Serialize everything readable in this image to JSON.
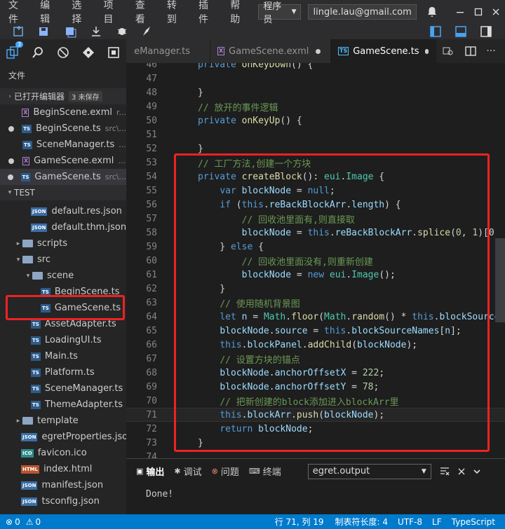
{
  "menu": [
    "文件",
    "编辑",
    "选择",
    "项目",
    "查看",
    "转到",
    "插件",
    "帮助"
  ],
  "account": {
    "role": "程序员",
    "email": "lingle.lau@gmail.com"
  },
  "activity": {
    "badge": "3"
  },
  "tabs": [
    {
      "label": "SceneManager.ts",
      "icon": "TS"
    },
    {
      "label": "GameScene.exml",
      "icon": "X"
    },
    {
      "label": "GameScene.ts",
      "icon": "TS"
    }
  ],
  "sidebar": {
    "title": "文件",
    "open_editors": {
      "label": "已打开编辑器",
      "badge": "3 未保存"
    },
    "open_files": [
      {
        "name": "BeginScene.exml",
        "path": "r...",
        "icon": "X",
        "dirty": false
      },
      {
        "name": "BeginScene.ts",
        "path": "src\\...",
        "icon": "TS",
        "dirty": true
      },
      {
        "name": "SceneManager.ts",
        "path": "...",
        "icon": "TS",
        "dirty": false
      },
      {
        "name": "GameScene.exml",
        "path": "...",
        "icon": "X",
        "dirty": true
      },
      {
        "name": "GameScene.ts",
        "path": "src\\...",
        "icon": "TS",
        "dirty": true
      }
    ],
    "project": "TEST",
    "tree": [
      {
        "name": "default.res.json",
        "icon": "JSON",
        "indent": 44
      },
      {
        "name": "default.thm.json",
        "icon": "JSON",
        "indent": 44
      },
      {
        "name": "scripts",
        "icon": "folder",
        "indent": 20,
        "arrow": "▸"
      },
      {
        "name": "src",
        "icon": "folder",
        "indent": 20,
        "arrow": "▾"
      },
      {
        "name": "scene",
        "icon": "folder",
        "indent": 34,
        "arrow": "▾"
      },
      {
        "name": "BeginScene.ts",
        "icon": "TS",
        "indent": 58
      },
      {
        "name": "GameScene.ts",
        "icon": "TS",
        "indent": 58
      },
      {
        "name": "AssetAdapter.ts",
        "icon": "TS",
        "indent": 44
      },
      {
        "name": "LoadingUI.ts",
        "icon": "TS",
        "indent": 44
      },
      {
        "name": "Main.ts",
        "icon": "TS",
        "indent": 44
      },
      {
        "name": "Platform.ts",
        "icon": "TS",
        "indent": 44
      },
      {
        "name": "SceneManager.ts",
        "icon": "TS",
        "indent": 44
      },
      {
        "name": "ThemeAdapter.ts",
        "icon": "TS",
        "indent": 44
      },
      {
        "name": "template",
        "icon": "folder",
        "indent": 20,
        "arrow": "▸"
      },
      {
        "name": "egretProperties.json",
        "icon": "JSON",
        "indent": 30
      },
      {
        "name": "favicon.ico",
        "icon": "ICO",
        "indent": 30
      },
      {
        "name": "index.html",
        "icon": "HTML",
        "indent": 30
      },
      {
        "name": "manifest.json",
        "icon": "JSON",
        "indent": 30
      },
      {
        "name": "tsconfig.json",
        "icon": "JSON",
        "indent": 30
      }
    ]
  },
  "code": [
    {
      "n": "46",
      "t": [
        [
          "kw",
          "private "
        ],
        [
          "fn",
          "onKeyDown"
        ],
        [
          "",
          "() {"
        ]
      ]
    },
    {
      "n": "47",
      "t": []
    },
    {
      "n": "48",
      "t": [
        [
          "",
          "}"
        ]
      ]
    },
    {
      "n": "49",
      "t": [
        [
          "cm",
          "// 放开的事件逻辑"
        ]
      ]
    },
    {
      "n": "50",
      "t": [
        [
          "kw",
          "private "
        ],
        [
          "fn",
          "onKeyUp"
        ],
        [
          "",
          "() {"
        ]
      ]
    },
    {
      "n": "51",
      "t": []
    },
    {
      "n": "52",
      "t": [
        [
          "",
          "}"
        ]
      ]
    },
    {
      "n": "53",
      "t": [
        [
          "cm",
          "// 工厂方法,创建一个方块"
        ]
      ]
    },
    {
      "n": "54",
      "t": [
        [
          "kw",
          "private "
        ],
        [
          "fn",
          "createBlock"
        ],
        [
          "",
          "(): "
        ],
        [
          "ty",
          "eui"
        ],
        [
          "",
          "."
        ],
        [
          "ty",
          "Image"
        ],
        [
          "",
          " {"
        ]
      ]
    },
    {
      "n": "55",
      "t": [
        [
          "",
          "    "
        ],
        [
          "kw",
          "var "
        ],
        [
          "pr",
          "blockNode"
        ],
        [
          "",
          " = "
        ],
        [
          "kw",
          "null"
        ],
        [
          "",
          ";"
        ]
      ]
    },
    {
      "n": "56",
      "t": [
        [
          "",
          "    "
        ],
        [
          "kw",
          "if "
        ],
        [
          "",
          "("
        ],
        [
          "kw",
          "this"
        ],
        [
          "",
          "."
        ],
        [
          "pr",
          "reBackBlockArr"
        ],
        [
          "",
          "."
        ],
        [
          "pr",
          "length"
        ],
        [
          "",
          ") {"
        ]
      ]
    },
    {
      "n": "57",
      "t": [
        [
          "",
          "        "
        ],
        [
          "cm",
          "// 回收池里面有,则直接取"
        ]
      ]
    },
    {
      "n": "58",
      "t": [
        [
          "",
          "        "
        ],
        [
          "pr",
          "blockNode"
        ],
        [
          "",
          " = "
        ],
        [
          "kw",
          "this"
        ],
        [
          "",
          "."
        ],
        [
          "pr",
          "reBackBlockArr"
        ],
        [
          "",
          "."
        ],
        [
          "fn",
          "splice"
        ],
        [
          "",
          "("
        ],
        [
          "nm",
          "0"
        ],
        [
          "",
          ", "
        ],
        [
          "nm",
          "1"
        ],
        [
          "",
          ")[0"
        ]
      ]
    },
    {
      "n": "59",
      "t": [
        [
          "",
          "    } "
        ],
        [
          "kw",
          "else "
        ],
        [
          "",
          "{"
        ]
      ]
    },
    {
      "n": "60",
      "t": [
        [
          "",
          "        "
        ],
        [
          "cm",
          "// 回收池里面没有,则重新创建"
        ]
      ]
    },
    {
      "n": "61",
      "t": [
        [
          "",
          "        "
        ],
        [
          "pr",
          "blockNode"
        ],
        [
          "",
          " = "
        ],
        [
          "kw",
          "new "
        ],
        [
          "ty",
          "eui"
        ],
        [
          "",
          "."
        ],
        [
          "ty",
          "Image"
        ],
        [
          "",
          "();"
        ]
      ]
    },
    {
      "n": "62",
      "t": [
        [
          "",
          "    }"
        ]
      ]
    },
    {
      "n": "63",
      "t": [
        [
          "",
          "    "
        ],
        [
          "cm",
          "// 使用随机背景图"
        ]
      ]
    },
    {
      "n": "64",
      "t": [
        [
          "",
          "    "
        ],
        [
          "kw",
          "let "
        ],
        [
          "pr",
          "n"
        ],
        [
          "",
          " = "
        ],
        [
          "ty",
          "Math"
        ],
        [
          "",
          "."
        ],
        [
          "fn",
          "floor"
        ],
        [
          "",
          "("
        ],
        [
          "ty",
          "Math"
        ],
        [
          "",
          "."
        ],
        [
          "fn",
          "random"
        ],
        [
          "",
          "() * "
        ],
        [
          "kw",
          "this"
        ],
        [
          "",
          "."
        ],
        [
          "pr",
          "blockSource"
        ]
      ]
    },
    {
      "n": "65",
      "t": [
        [
          "",
          "    "
        ],
        [
          "pr",
          "blockNode"
        ],
        [
          "",
          "."
        ],
        [
          "pr",
          "source"
        ],
        [
          "",
          " = "
        ],
        [
          "kw",
          "this"
        ],
        [
          "",
          "."
        ],
        [
          "pr",
          "blockSourceNames"
        ],
        [
          "",
          "["
        ],
        [
          "pr",
          "n"
        ],
        [
          "",
          "];"
        ]
      ]
    },
    {
      "n": "66",
      "t": [
        [
          "",
          "    "
        ],
        [
          "kw",
          "this"
        ],
        [
          "",
          "."
        ],
        [
          "pr",
          "blockPanel"
        ],
        [
          "",
          "."
        ],
        [
          "fn",
          "addChild"
        ],
        [
          "",
          "("
        ],
        [
          "pr",
          "blockNode"
        ],
        [
          "",
          ");"
        ]
      ]
    },
    {
      "n": "67",
      "t": [
        [
          "",
          "    "
        ],
        [
          "cm",
          "// 设置方块的锚点"
        ]
      ]
    },
    {
      "n": "68",
      "t": [
        [
          "",
          "    "
        ],
        [
          "pr",
          "blockNode"
        ],
        [
          "",
          "."
        ],
        [
          "pr",
          "anchorOffsetX"
        ],
        [
          "",
          " = "
        ],
        [
          "nm",
          "222"
        ],
        [
          "",
          ";"
        ]
      ]
    },
    {
      "n": "69",
      "t": [
        [
          "",
          "    "
        ],
        [
          "pr",
          "blockNode"
        ],
        [
          "",
          "."
        ],
        [
          "pr",
          "anchorOffsetY"
        ],
        [
          "",
          " = "
        ],
        [
          "nm",
          "78"
        ],
        [
          "",
          ";"
        ]
      ]
    },
    {
      "n": "70",
      "t": [
        [
          "",
          "    "
        ],
        [
          "cm",
          "// 把新创建的block添加进入blockArr里"
        ]
      ]
    },
    {
      "n": "71",
      "t": [
        [
          "",
          "    "
        ],
        [
          "kw",
          "this"
        ],
        [
          "",
          "."
        ],
        [
          "pr",
          "blockArr"
        ],
        [
          "",
          "."
        ],
        [
          "fn",
          "push"
        ],
        [
          "",
          "("
        ],
        [
          "pr",
          "blockNode"
        ],
        [
          "",
          ");"
        ]
      ]
    },
    {
      "n": "72",
      "t": [
        [
          "",
          "    "
        ],
        [
          "kw",
          "return "
        ],
        [
          "pr",
          "blockNode"
        ],
        [
          "",
          ";"
        ]
      ]
    },
    {
      "n": "73",
      "t": [
        [
          "",
          "}"
        ]
      ]
    },
    {
      "n": "74",
      "t": []
    }
  ],
  "panel": {
    "tabs": [
      "输出",
      "调试",
      "问题",
      "终端"
    ],
    "channel": "egret.output",
    "output": "Done!"
  },
  "status": {
    "errors": "0",
    "warnings": "0",
    "position": "行 71, 列 19",
    "tabsize": "制表符长度: 4",
    "encoding": "UTF-8",
    "eol": "LF",
    "language": "TypeScript"
  }
}
